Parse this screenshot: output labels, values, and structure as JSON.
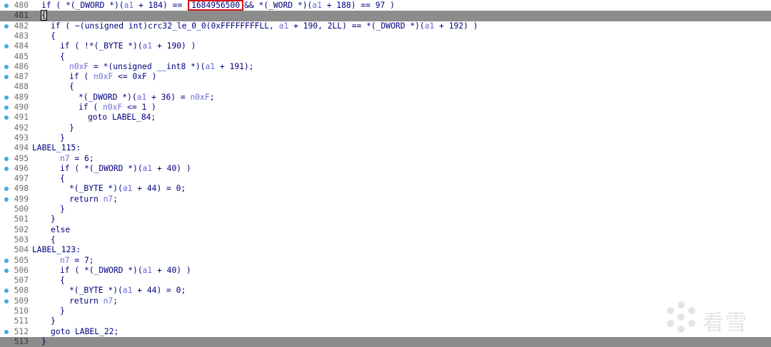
{
  "code_view": {
    "lines": [
      {
        "n": "480",
        "bp": true,
        "indent": 1,
        "segs": [
          {
            "t": "if ( *(_DWORD *)("
          },
          {
            "t": "a1",
            "c": "v"
          },
          {
            "t": " + 184) == "
          },
          {
            "t": "1684956500",
            "c": "box"
          },
          {
            "t": "&& *(_WORD *)("
          },
          {
            "t": "a1",
            "c": "v"
          },
          {
            "t": " + 188) == 97 )"
          }
        ]
      },
      {
        "n": "481",
        "bp": false,
        "indent": 1,
        "hl": true,
        "segs": [
          {
            "t": "{",
            "c": "cbrace"
          }
        ]
      },
      {
        "n": "482",
        "bp": true,
        "indent": 2,
        "segs": [
          {
            "t": "if ( ~(unsigned int)crc32_le_0_0(0xFFFFFFFFLL, "
          },
          {
            "t": "a1",
            "c": "v"
          },
          {
            "t": " + 190, 2LL) == *(_DWORD *)("
          },
          {
            "t": "a1",
            "c": "v"
          },
          {
            "t": " + 192) )"
          }
        ]
      },
      {
        "n": "483",
        "bp": false,
        "indent": 2,
        "segs": [
          {
            "t": "{"
          }
        ]
      },
      {
        "n": "484",
        "bp": true,
        "indent": 3,
        "segs": [
          {
            "t": "if ( !*(_BYTE *)("
          },
          {
            "t": "a1",
            "c": "v"
          },
          {
            "t": " + 190) )"
          }
        ]
      },
      {
        "n": "485",
        "bp": false,
        "indent": 3,
        "segs": [
          {
            "t": "{"
          }
        ]
      },
      {
        "n": "486",
        "bp": true,
        "indent": 4,
        "segs": [
          {
            "t": "n0xF",
            "c": "v"
          },
          {
            "t": " = *(unsigned __int8 *)("
          },
          {
            "t": "a1",
            "c": "v"
          },
          {
            "t": " + 191);"
          }
        ]
      },
      {
        "n": "487",
        "bp": true,
        "indent": 4,
        "segs": [
          {
            "t": "if ( "
          },
          {
            "t": "n0xF",
            "c": "v"
          },
          {
            "t": " <= 0xF )"
          }
        ]
      },
      {
        "n": "488",
        "bp": false,
        "indent": 4,
        "segs": [
          {
            "t": "{"
          }
        ]
      },
      {
        "n": "489",
        "bp": true,
        "indent": 5,
        "segs": [
          {
            "t": "*(_DWORD *)("
          },
          {
            "t": "a1",
            "c": "v"
          },
          {
            "t": " + 36) = "
          },
          {
            "t": "n0xF",
            "c": "v"
          },
          {
            "t": ";"
          }
        ]
      },
      {
        "n": "490",
        "bp": true,
        "indent": 5,
        "segs": [
          {
            "t": "if ( "
          },
          {
            "t": "n0xF",
            "c": "v"
          },
          {
            "t": " <= 1 )"
          }
        ]
      },
      {
        "n": "491",
        "bp": true,
        "indent": 6,
        "segs": [
          {
            "t": "goto LABEL_84;"
          }
        ]
      },
      {
        "n": "492",
        "bp": false,
        "indent": 4,
        "segs": [
          {
            "t": "}"
          }
        ]
      },
      {
        "n": "493",
        "bp": false,
        "indent": 3,
        "segs": [
          {
            "t": "}"
          }
        ]
      },
      {
        "n": "494",
        "bp": false,
        "indent": 0,
        "segs": [
          {
            "t": "LABEL_115:"
          }
        ]
      },
      {
        "n": "495",
        "bp": true,
        "indent": 3,
        "segs": [
          {
            "t": "n7",
            "c": "v"
          },
          {
            "t": " = 6;"
          }
        ]
      },
      {
        "n": "496",
        "bp": true,
        "indent": 3,
        "segs": [
          {
            "t": "if ( *(_DWORD *)("
          },
          {
            "t": "a1",
            "c": "v"
          },
          {
            "t": " + 40) )"
          }
        ]
      },
      {
        "n": "497",
        "bp": false,
        "indent": 3,
        "segs": [
          {
            "t": "{"
          }
        ]
      },
      {
        "n": "498",
        "bp": true,
        "indent": 4,
        "segs": [
          {
            "t": "*(_BYTE *)("
          },
          {
            "t": "a1",
            "c": "v"
          },
          {
            "t": " + 44) = 0;"
          }
        ]
      },
      {
        "n": "499",
        "bp": true,
        "indent": 4,
        "segs": [
          {
            "t": "return "
          },
          {
            "t": "n7",
            "c": "v"
          },
          {
            "t": ";"
          }
        ]
      },
      {
        "n": "500",
        "bp": false,
        "indent": 3,
        "segs": [
          {
            "t": "}"
          }
        ]
      },
      {
        "n": "501",
        "bp": false,
        "indent": 2,
        "segs": [
          {
            "t": "}"
          }
        ]
      },
      {
        "n": "502",
        "bp": false,
        "indent": 2,
        "segs": [
          {
            "t": "else"
          }
        ]
      },
      {
        "n": "503",
        "bp": false,
        "indent": 2,
        "segs": [
          {
            "t": "{"
          }
        ]
      },
      {
        "n": "504",
        "bp": false,
        "indent": 0,
        "segs": [
          {
            "t": "LABEL_123:"
          }
        ]
      },
      {
        "n": "505",
        "bp": true,
        "indent": 3,
        "segs": [
          {
            "t": "n7",
            "c": "v"
          },
          {
            "t": " = 7;"
          }
        ]
      },
      {
        "n": "506",
        "bp": true,
        "indent": 3,
        "segs": [
          {
            "t": "if ( *(_DWORD *)("
          },
          {
            "t": "a1",
            "c": "v"
          },
          {
            "t": " + 40) )"
          }
        ]
      },
      {
        "n": "507",
        "bp": false,
        "indent": 3,
        "segs": [
          {
            "t": "{"
          }
        ]
      },
      {
        "n": "508",
        "bp": true,
        "indent": 4,
        "segs": [
          {
            "t": "*(_BYTE *)("
          },
          {
            "t": "a1",
            "c": "v"
          },
          {
            "t": " + 44) = 0;"
          }
        ]
      },
      {
        "n": "509",
        "bp": true,
        "indent": 4,
        "segs": [
          {
            "t": "return "
          },
          {
            "t": "n7",
            "c": "v"
          },
          {
            "t": ";"
          }
        ]
      },
      {
        "n": "510",
        "bp": false,
        "indent": 3,
        "segs": [
          {
            "t": "}"
          }
        ]
      },
      {
        "n": "511",
        "bp": false,
        "indent": 2,
        "segs": [
          {
            "t": "}"
          }
        ]
      },
      {
        "n": "512",
        "bp": true,
        "indent": 2,
        "segs": [
          {
            "t": "goto LABEL_22;"
          }
        ]
      },
      {
        "n": "513",
        "bp": false,
        "indent": 1,
        "hl": true,
        "segs": [
          {
            "t": "}"
          }
        ]
      }
    ]
  },
  "watermark": {
    "text": "看雪",
    "icon": "snowflake-logo-icon"
  },
  "colors": {
    "keyword_text": "#000080",
    "variable_text": "#6b6bd6",
    "line_number": "#6f6f6f",
    "breakpoint_dot": "#41a9e6",
    "highlight_row": "#8c8c8c",
    "annotation_box": "#d11414"
  }
}
